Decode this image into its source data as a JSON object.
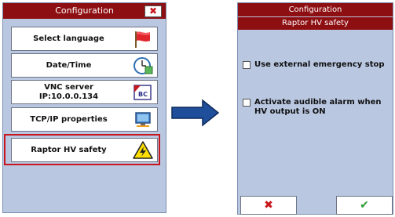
{
  "left_window": {
    "title": "Configuration",
    "close_glyph": "✖",
    "items": [
      {
        "label_line1": "Select language",
        "label_line2": "",
        "icon": "red-flag-icon"
      },
      {
        "label_line1": "Date/Time",
        "label_line2": "",
        "icon": "clock-icon"
      },
      {
        "label_line1": "VNC server",
        "label_line2": "IP:10.0.0.134",
        "icon": "vnc-icon"
      },
      {
        "label_line1": "TCP/IP properties",
        "label_line2": "",
        "icon": "computer-network-icon"
      },
      {
        "label_line1": "Raptor HV safety",
        "label_line2": "",
        "icon": "high-voltage-warning-icon"
      }
    ],
    "vnc_icon_text": "BC"
  },
  "right_window": {
    "title": "Configuration",
    "subtitle": "Raptor HV safety",
    "options": [
      {
        "label": "Use external emergency stop",
        "checked": false
      },
      {
        "label": "Activate audible alarm when HV output is ON",
        "checked": false
      }
    ],
    "cancel_glyph": "✖",
    "ok_glyph": "✔"
  },
  "colors": {
    "title_bar": "#8e0f12",
    "window_bg": "#b9c7e1",
    "highlight": "#c8161d",
    "arrow": "#1f4f9a",
    "ok_green": "#2e9d2e",
    "cancel_red": "#c8161d"
  }
}
